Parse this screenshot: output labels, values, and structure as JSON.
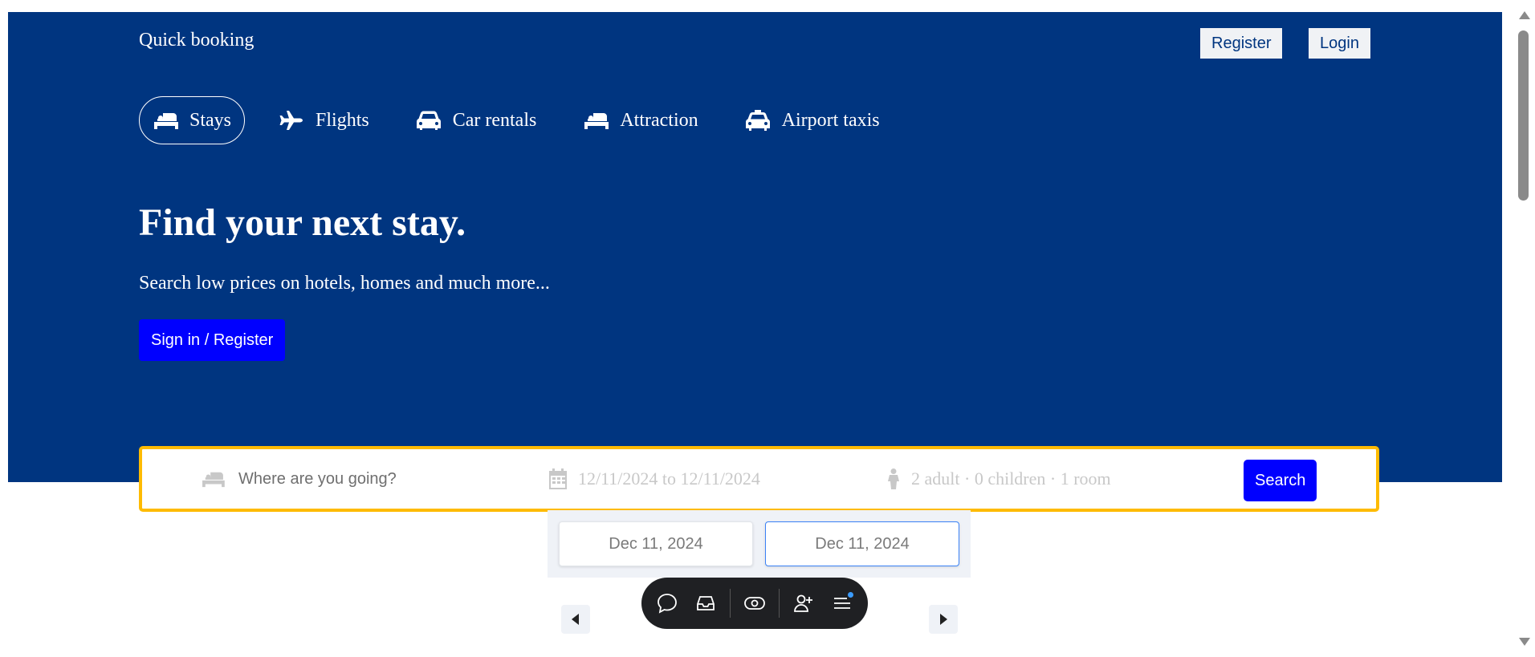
{
  "header": {
    "brand": "Quick booking",
    "register_label": "Register",
    "login_label": "Login"
  },
  "nav": {
    "items": [
      {
        "label": "Stays",
        "icon": "bed-icon",
        "active": true
      },
      {
        "label": "Flights",
        "icon": "plane-icon",
        "active": false
      },
      {
        "label": "Car rentals",
        "icon": "car-icon",
        "active": false
      },
      {
        "label": "Attraction",
        "icon": "bed-icon",
        "active": false
      },
      {
        "label": "Airport taxis",
        "icon": "taxi-icon",
        "active": false
      }
    ]
  },
  "hero": {
    "title": "Find your next stay.",
    "subtitle": "Search low prices on hotels, homes and much more...",
    "signin_label": "Sign in / Register"
  },
  "search": {
    "destination_placeholder": "Where are you going?",
    "dates_text": "12/11/2024 to 12/11/2024",
    "guests_text": "2 adult · 0 children · 1 room",
    "search_label": "Search"
  },
  "datepicker": {
    "start_date": "Dec 11, 2024",
    "end_date": "Dec 11, 2024"
  },
  "colors": {
    "hero_bg": "#003580",
    "accent_blue": "#0000ff",
    "search_border": "#febb02"
  }
}
